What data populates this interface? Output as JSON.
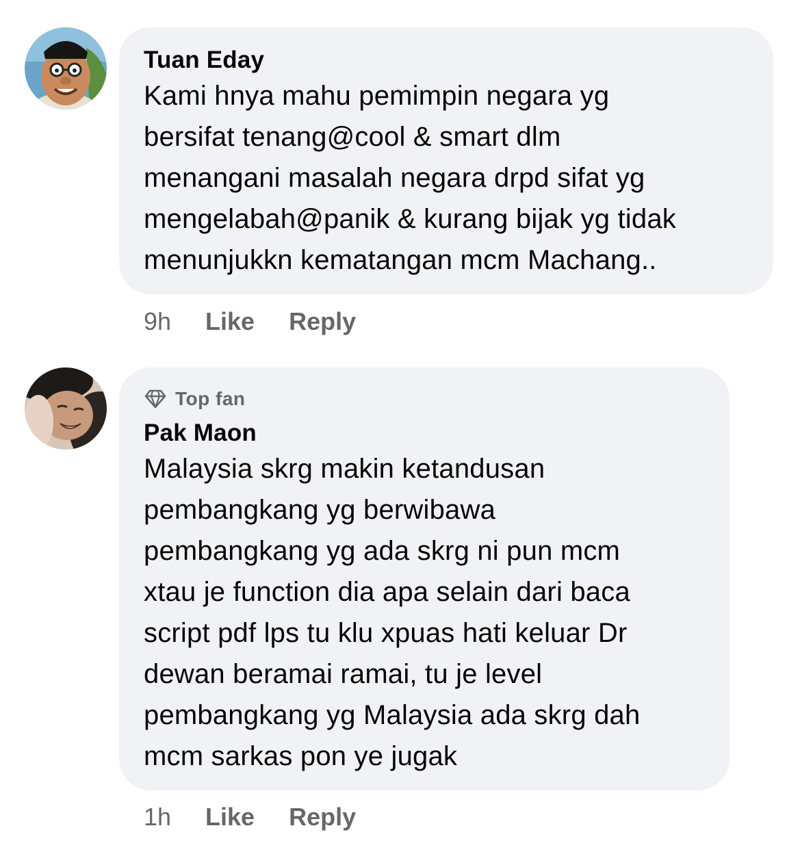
{
  "comments": [
    {
      "author": "Tuan Eday",
      "text": "Kami hnya mahu pemimpin negara yg\nbersifat tenang@cool & smart dlm\nmenangani masalah negara drpd sifat yg\nmengelabah@panik & kurang bijak yg tidak\nmenunjukkn kematangan mcm Machang..",
      "time": "9h",
      "like_label": "Like",
      "reply_label": "Reply"
    },
    {
      "badge": "Top fan",
      "author": "Pak Maon",
      "text": "Malaysia skrg makin ketandusan\npembangkang yg berwibawa\npembangkang yg ada skrg ni pun mcm\nxtau je function dia apa selain dari baca\nscript pdf lps tu klu xpuas hati keluar Dr\ndewan beramai ramai, tu je level\npembangkang yg Malaysia ada skrg dah\nmcm sarkas pon ye jugak",
      "time": "1h",
      "like_label": "Like",
      "reply_label": "Reply"
    }
  ],
  "icons": {
    "badge_icon": "diamond-icon"
  },
  "colors": {
    "bubble": "#f0f2f5",
    "text": "#050505",
    "meta": "#65676b"
  }
}
